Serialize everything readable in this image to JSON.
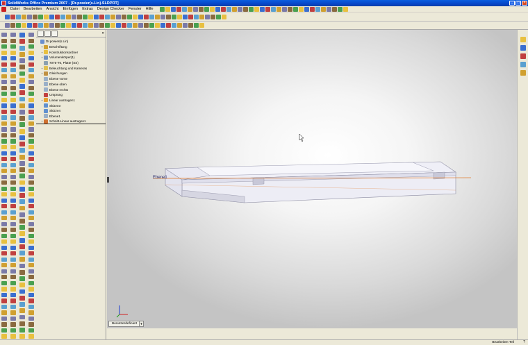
{
  "window": {
    "title": "SolidWorks Office Premium 2007 - [Dr.powier(s.Lin).SLDPRT]",
    "controls": [
      "_",
      "□",
      "×"
    ]
  },
  "menu": {
    "items": [
      "Datei",
      "Bearbeiten",
      "Ansicht",
      "Einfügen",
      "Extras",
      "Design Checker",
      "Fenster",
      "Hilfe"
    ]
  },
  "feature_manager": {
    "tree": [
      {
        "label": "Dr.powier(s.Lin)",
        "icon": "part-icon",
        "level": 0,
        "expander": ""
      },
      {
        "label": "Beschriftung",
        "icon": "annotation-icon",
        "level": 1,
        "expander": "+"
      },
      {
        "label": "Konstruktionsordner",
        "icon": "folder-icon",
        "level": 1,
        "expander": "+"
      },
      {
        "label": "Volumenkörper(1)",
        "icon": "solid-bodies-icon",
        "level": 1,
        "expander": "+"
      },
      {
        "label": "7075-T6, Platte (SS)",
        "icon": "material-icon",
        "level": 1,
        "expander": ""
      },
      {
        "label": "Beleuchtung und Kameras",
        "icon": "lights-icon",
        "level": 1,
        "expander": "+"
      },
      {
        "label": "Gleichungen",
        "icon": "equations-icon",
        "level": 1,
        "expander": "+"
      },
      {
        "label": "Ebene vorne",
        "icon": "plane-icon",
        "level": 1,
        "expander": ""
      },
      {
        "label": "Ebene oben",
        "icon": "plane-icon",
        "level": 1,
        "expander": ""
      },
      {
        "label": "Ebene rechts",
        "icon": "plane-icon",
        "level": 1,
        "expander": ""
      },
      {
        "label": "Ursprung",
        "icon": "origin-icon",
        "level": 1,
        "expander": ""
      },
      {
        "label": "Linear austragen1",
        "icon": "extrude-icon",
        "level": 1,
        "expander": "+"
      },
      {
        "label": "Skizze3",
        "icon": "sketch-icon",
        "level": 1,
        "expander": ""
      },
      {
        "label": "Skizze4",
        "icon": "sketch-icon",
        "level": 1,
        "expander": ""
      },
      {
        "label": "Ebene1",
        "icon": "plane-icon",
        "level": 1,
        "expander": ""
      },
      {
        "label": "Schnitt-Linear austragen1",
        "icon": "cut-extrude-icon",
        "level": 1,
        "expander": "+"
      }
    ]
  },
  "viewport": {
    "plane_label": "Ebene1",
    "model_tab": "Benutzerdefiniert",
    "model_tab_arrow": "▼"
  },
  "statusbar": {
    "status": "Bearbeiten Teil",
    "help": "?"
  },
  "colors": {
    "model_face": "#ededf6",
    "model_side": "#dcdcea",
    "plane_line": "#e07a2a",
    "title_blue": "#0a4fd0"
  }
}
